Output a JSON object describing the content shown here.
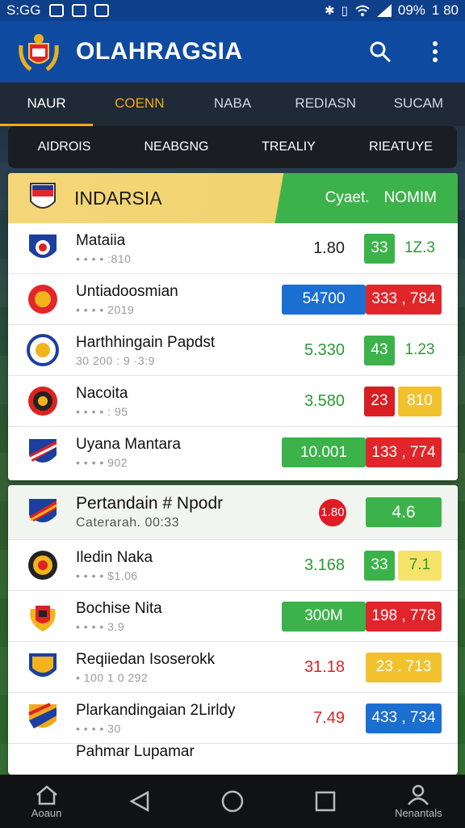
{
  "status_bar": {
    "time": "S:GG",
    "battery": "09%",
    "clock_right": "1 80"
  },
  "app": {
    "title": "OLAHRAGSIA"
  },
  "tabs": [
    {
      "label": "NAUR",
      "active": true
    },
    {
      "label": "COENN",
      "accent": true
    },
    {
      "label": "NABA"
    },
    {
      "label": "REDIASN"
    },
    {
      "label": "SUCAM"
    }
  ],
  "subtabs": [
    "AIDROIS",
    "NEABGNG",
    "TREALIY",
    "RIEATUYE"
  ],
  "league1": {
    "name": "INDARSIA",
    "extra_left": "Cyaet.",
    "extra_right": "NOMIM",
    "rows": [
      {
        "name": "Mataiia",
        "meta": "• • • • :810",
        "score": "1.80",
        "pill_a": "33",
        "pill_b": "1Z.3"
      },
      {
        "name": "Untiadoosmian",
        "meta": "• • • • 2019",
        "pill_a": "54700",
        "pill_b": "333 , 784"
      },
      {
        "name": "Harthhingain Papdst",
        "meta": "30 200 : 9 ·3:9",
        "score": "5.330",
        "pill_a": "43",
        "pill_b": "1.23"
      },
      {
        "name": "Nacoita",
        "meta": "• • • • : 95",
        "score": "3.580",
        "pill_a": "23",
        "pill_b": "810"
      },
      {
        "name": "Uyana Mantara",
        "meta": "• • • • 902",
        "pill_a": "10.001",
        "pill_b": "133 , 774"
      }
    ]
  },
  "league2": {
    "featured": {
      "name": "Pertandain # Npodr",
      "meta": "Caterarah. 00:33",
      "score": "1.80",
      "pill": "4.6"
    },
    "rows": [
      {
        "name": "Iledin Naka",
        "meta": "• • • • $1.06",
        "score": "3.168",
        "pill_a": "33",
        "pill_b": "7.1"
      },
      {
        "name": "Bochise Nita",
        "meta": "• • • • 3.9",
        "pill_a": "300M",
        "pill_b": "198 , 778"
      },
      {
        "name": "Reqiiedan Isoserokk",
        "meta": "• 100 1 0 292",
        "score": "31.18",
        "pill_a": "23 . 713"
      },
      {
        "name": "Plarkandingaian 2Lirldy",
        "meta": "• • • • 30",
        "score": "7.49",
        "pill_a": "433 , 734"
      }
    ],
    "partial_row": "Pahmar Lupamar"
  },
  "nav": {
    "left_label": "Aoaun",
    "right_label": "Nenantals"
  },
  "colors": {
    "primary": "#0e4aa0",
    "green": "#3cb24b",
    "red": "#e0262b",
    "blue": "#1b6fd0",
    "yellow": "#f2c12e",
    "tab_accent": "#f2a81d"
  }
}
